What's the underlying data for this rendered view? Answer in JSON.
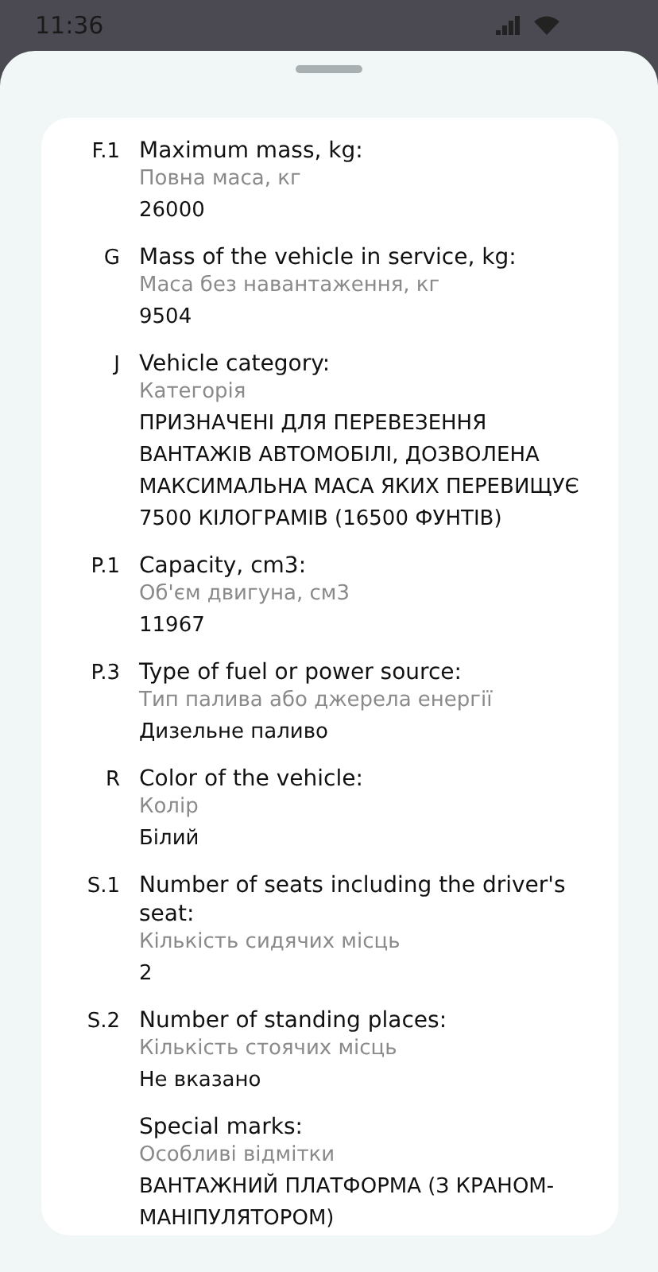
{
  "status_bar": {
    "time": "11:36"
  },
  "fields": [
    {
      "code": "F.1",
      "title": "Maximum mass, kg:",
      "subtitle": "Повна маса, кг",
      "value": "26000"
    },
    {
      "code": "G",
      "title": "Mass of the vehicle in service, kg:",
      "subtitle": "Маса без навантаження, кг",
      "value": "9504"
    },
    {
      "code": "J",
      "title": "Vehicle category:",
      "subtitle": "Категорія",
      "value": "ПРИЗНАЧЕНІ ДЛЯ ПЕРЕВЕЗЕННЯ ВАНТАЖІВ АВТОМОБІЛІ, ДОЗВОЛЕНА МАКСИМАЛЬНА МАСА ЯКИХ ПЕРЕВИЩУЄ 7500 КІЛОГРАМІВ (16500 ФУНТІВ)"
    },
    {
      "code": "P.1",
      "title": "Capacity, cm3:",
      "subtitle": "Об'єм двигуна, см3",
      "value": "11967"
    },
    {
      "code": "P.3",
      "title": "Type of fuel or power source:",
      "subtitle": "Тип палива або джерела енергії",
      "value": "Дизельне паливо"
    },
    {
      "code": "R",
      "title": "Color of the vehicle:",
      "subtitle": "Колір",
      "value": "Білий"
    },
    {
      "code": "S.1",
      "title": "Number of seats including the driver's seat:",
      "subtitle": "Кількість сидячих місць",
      "value": "2"
    },
    {
      "code": "S.2",
      "title": "Number of standing places:",
      "subtitle": "Кількість стоячих місць",
      "value": "Не вказано"
    },
    {
      "title": "Special marks:",
      "subtitle": "Особливі відмітки",
      "value": "ВАНТАЖНИЙ ПЛАТФОРМА (З КРАНОМ-МАНІПУЛЯТОРОМ)"
    }
  ]
}
